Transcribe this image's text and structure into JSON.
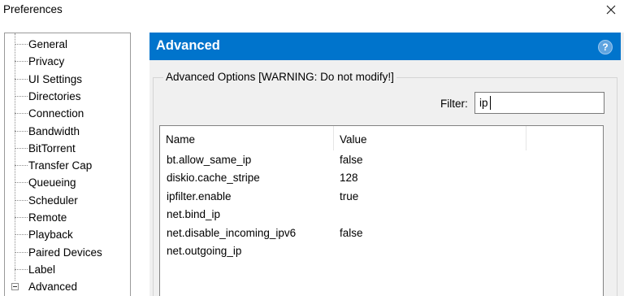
{
  "window": {
    "title": "Preferences",
    "close_icon": "close-icon"
  },
  "sidebar": {
    "items": [
      {
        "label": "General"
      },
      {
        "label": "Privacy"
      },
      {
        "label": "UI Settings"
      },
      {
        "label": "Directories"
      },
      {
        "label": "Connection"
      },
      {
        "label": "Bandwidth"
      },
      {
        "label": "BitTorrent"
      },
      {
        "label": "Transfer Cap"
      },
      {
        "label": "Queueing"
      },
      {
        "label": "Scheduler"
      },
      {
        "label": "Remote"
      },
      {
        "label": "Playback"
      },
      {
        "label": "Paired Devices"
      },
      {
        "label": "Label"
      },
      {
        "label": "Advanced",
        "expanded": true
      }
    ]
  },
  "panel": {
    "header_title": "Advanced",
    "header_color": "#0074cc",
    "help_label": "?",
    "group_label": "Advanced Options [WARNING: Do not modify!]",
    "filter": {
      "label": "Filter:",
      "value": "ip"
    },
    "columns": {
      "name": "Name",
      "value": "Value"
    },
    "rows": [
      {
        "name": "bt.allow_same_ip",
        "value": "false"
      },
      {
        "name": "diskio.cache_stripe",
        "value": "128"
      },
      {
        "name": "ipfilter.enable",
        "value": "true"
      },
      {
        "name": "net.bind_ip",
        "value": ""
      },
      {
        "name": "net.disable_incoming_ipv6",
        "value": "false"
      },
      {
        "name": "net.outgoing_ip",
        "value": ""
      }
    ]
  }
}
